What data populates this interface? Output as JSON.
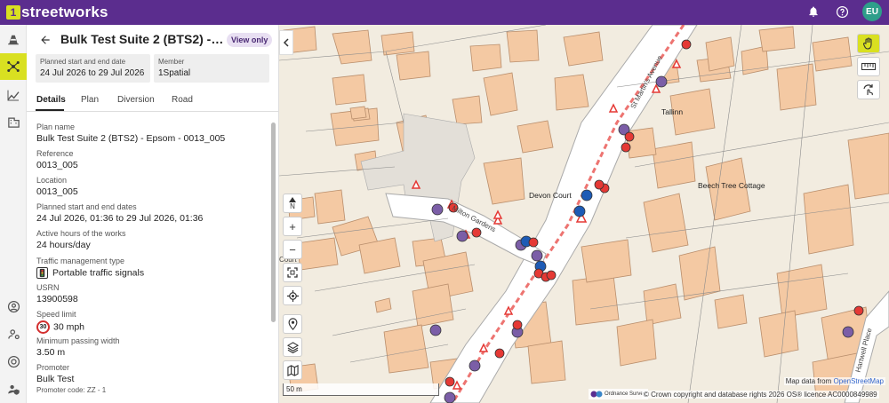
{
  "app": {
    "logo_mark": "1",
    "name": "streetworks"
  },
  "user": {
    "initials": "EU"
  },
  "colors": {
    "brand": "#5b2d8e",
    "accent": "#d9e021",
    "avatar": "#2e9e8a",
    "badge_bg": "#e8dff2"
  },
  "rail": {
    "icons": [
      "traffic-cone-icon",
      "network-icon",
      "analytics-icon",
      "building-icon",
      "account-circle-icon",
      "manage-accounts-icon",
      "support-icon",
      "admin-icon"
    ],
    "active_index": 1
  },
  "panel": {
    "title": "Bulk Test Suite 2 (BTS2) - Eps...",
    "badge": "View only",
    "dates_box": {
      "label": "Planned start and end date",
      "value": "24 Jul 2026 to 29 Jul 2026"
    },
    "member_box": {
      "label": "Member",
      "value": "1Spatial"
    },
    "tabs": [
      "Details",
      "Plan",
      "Diversion",
      "Road"
    ],
    "active_tab": "Details",
    "fields": {
      "plan_name": {
        "label": "Plan name",
        "value": "Bulk Test Suite 2 (BTS2) - Epsom - 0013_005"
      },
      "reference": {
        "label": "Reference",
        "value": "0013_005"
      },
      "location": {
        "label": "Location",
        "value": "0013_005"
      },
      "planned_dates": {
        "label": "Planned start and end dates",
        "value": "24 Jul 2026, 01:36 to 29 Jul 2026, 01:36"
      },
      "active_hours": {
        "label": "Active hours of the works",
        "value": "24 hours/day"
      },
      "traffic_mgmt": {
        "label": "Traffic management type",
        "value": "Portable traffic signals"
      },
      "usrn": {
        "label": "USRN",
        "value": "13900598"
      },
      "speed_limit": {
        "label": "Speed limit",
        "value": "30 mph",
        "badge": "30"
      },
      "min_passing": {
        "label": "Minimum passing width",
        "value": "3.50 m"
      },
      "promoter": {
        "label": "Promoter",
        "value": "Bulk Test"
      },
      "promoter_code": "Promoter code: ZZ - 1"
    }
  },
  "map": {
    "controls": {
      "north": "N",
      "zoom_in": "+",
      "zoom_out": "−"
    },
    "labels": {
      "devon_court": "Devon Court",
      "beech_tree": "Beech Tree Cottage",
      "tallinn": "Tallinn",
      "st_martins": "St Martin's Avenue",
      "milton": "Milton Gardens",
      "hartwell": "Hartwell Place",
      "court": "Court"
    },
    "scale": "50 m",
    "attribution_prefix": "Map data from ",
    "attribution_link": "OpenStreetMap",
    "copyright": "© Crown copyright and database rights 2026 OS® licence AC0000849989",
    "os_logo": "Ordnance Survey"
  }
}
